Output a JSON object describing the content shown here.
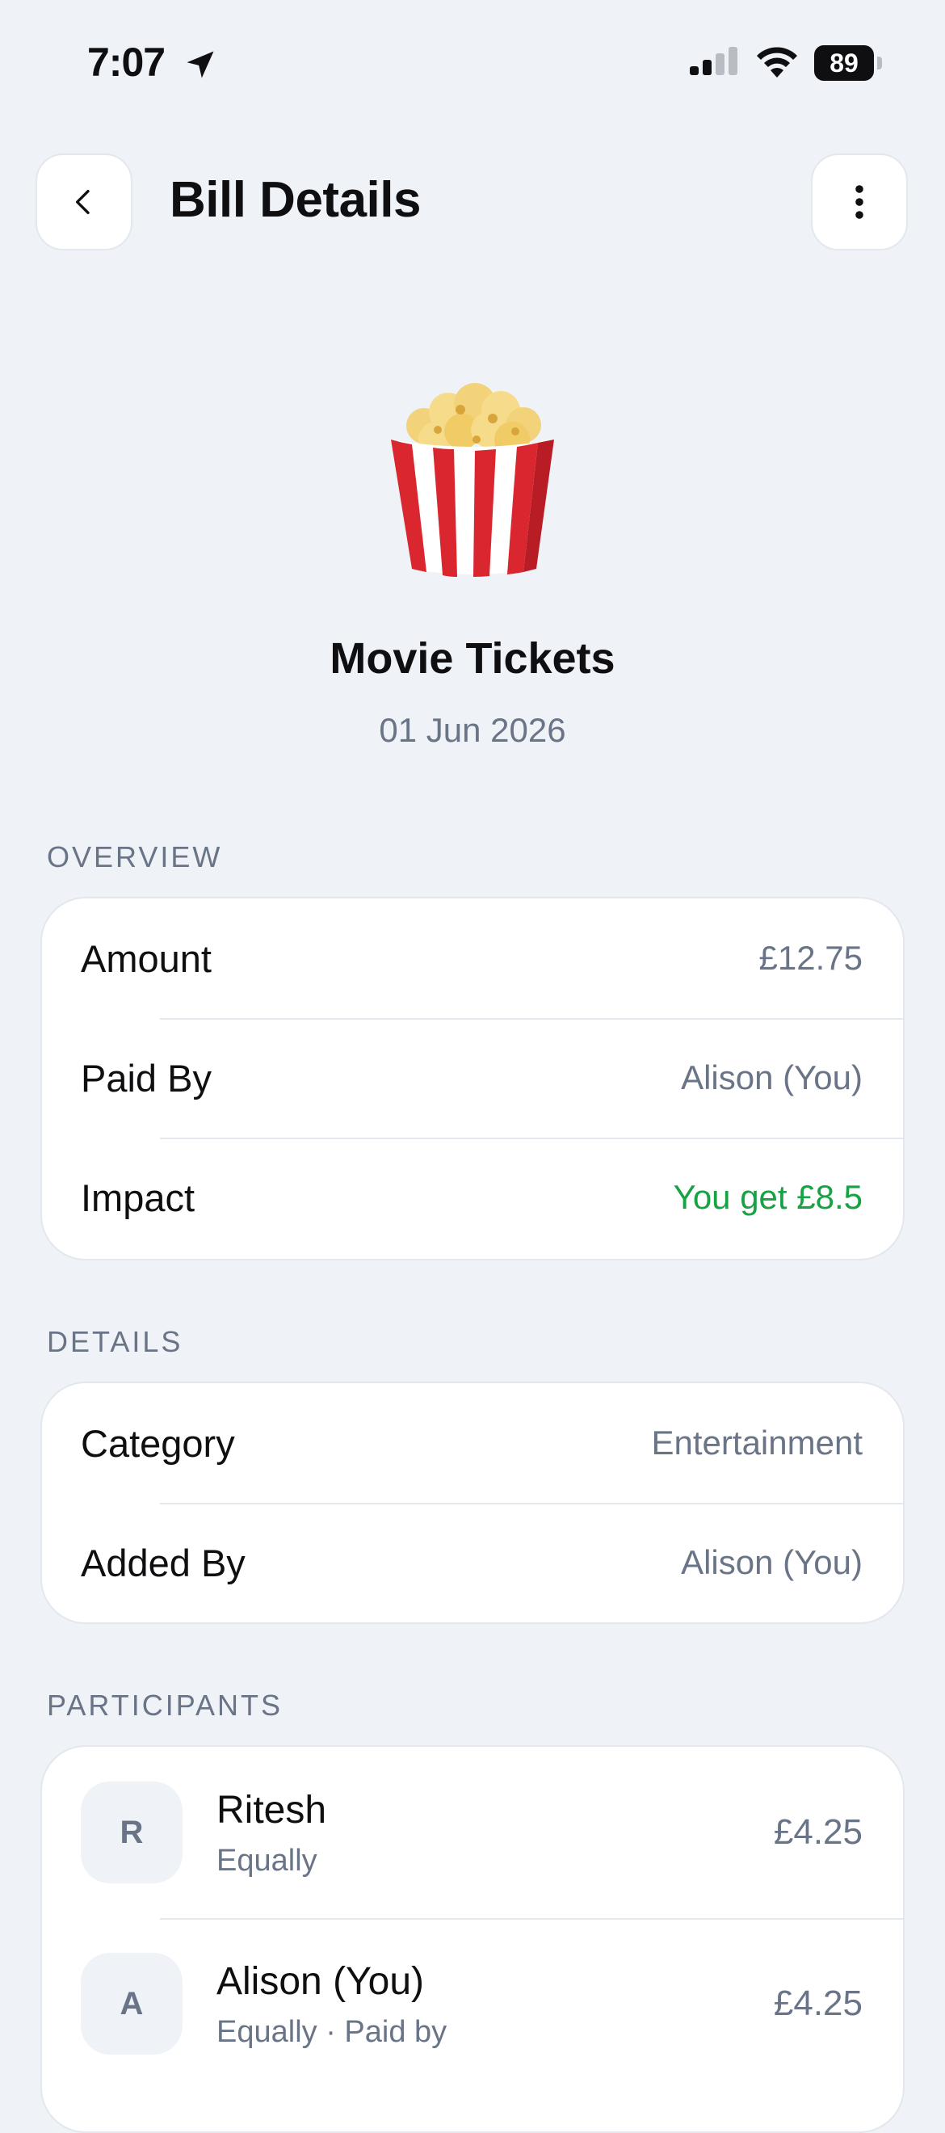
{
  "status_bar": {
    "time": "7:07",
    "battery": "89"
  },
  "header": {
    "title": "Bill Details"
  },
  "bill": {
    "icon": "popcorn-icon",
    "name": "Movie Tickets",
    "date": "01 Jun 2026"
  },
  "overview": {
    "label": "OVERVIEW",
    "rows": [
      {
        "label": "Amount",
        "value": "£12.75"
      },
      {
        "label": "Paid By",
        "value": "Alison (You)"
      },
      {
        "label": "Impact",
        "value": "You get £8.5"
      }
    ]
  },
  "details": {
    "label": "DETAILS",
    "rows": [
      {
        "label": "Category",
        "value": "Entertainment"
      },
      {
        "label": "Added By",
        "value": "Alison (You)"
      }
    ]
  },
  "participants": {
    "label": "PARTICIPANTS",
    "items": [
      {
        "initial": "R",
        "name": "Ritesh",
        "split": "Equally",
        "amount": "£4.25"
      },
      {
        "initial": "A",
        "name": "Alison (You)",
        "split": "Equally · Paid by",
        "amount": "£4.25"
      }
    ]
  },
  "colors": {
    "background": "#eff2f7",
    "positive": "#17a244",
    "muted": "#6a7487"
  }
}
